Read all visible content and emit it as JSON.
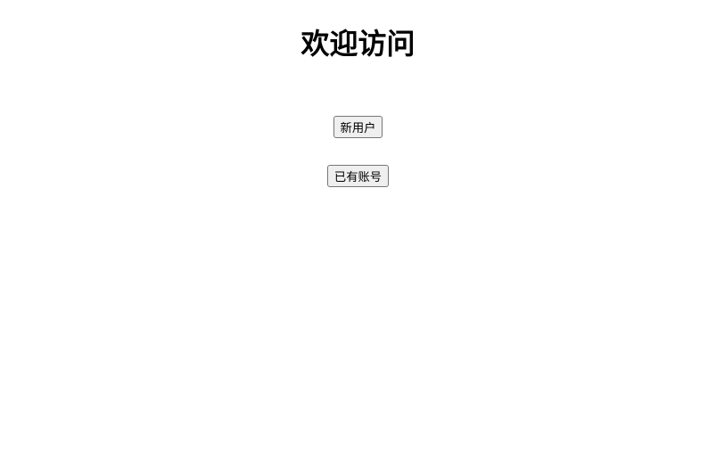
{
  "heading": "欢迎访问",
  "buttons": {
    "new_user": "新用户",
    "existing_account": "已有账号"
  }
}
